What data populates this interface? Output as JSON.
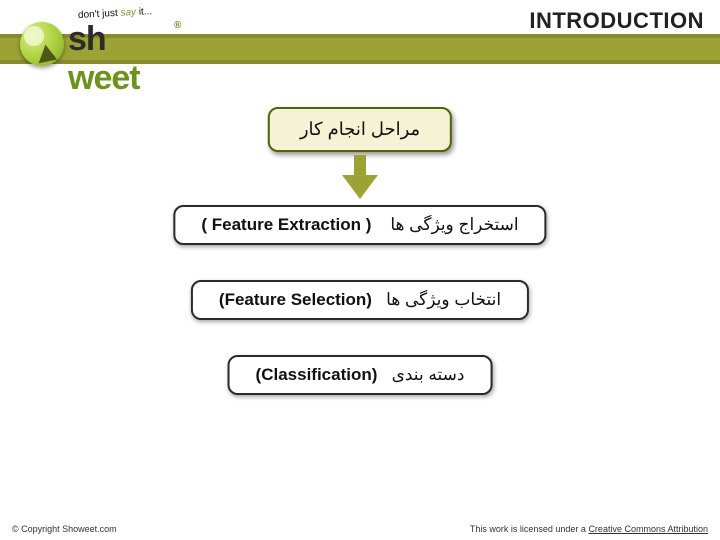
{
  "header": {
    "title": "INTRODUCTION"
  },
  "logo": {
    "tagline_pre": "don't just ",
    "tagline_say": "say",
    "tagline_post": " it...",
    "text_left": "sh",
    "text_right": "weet",
    "reg": "®"
  },
  "boxes": {
    "top_fa": "مراحل انجام کار",
    "feature_extraction": {
      "en": "( Feature Extraction )",
      "fa": "استخراج ویژگی ها"
    },
    "feature_selection": {
      "en": "(Feature Selection)",
      "fa": "انتخاب ویژگی ها"
    },
    "classification": {
      "en": "(Classification)",
      "fa": "دسته بندی"
    }
  },
  "footer": {
    "copyright": "© Copyright Showeet.com",
    "license_pre": "This work is licensed under a ",
    "license_link": "Creative Commons Attribution"
  }
}
